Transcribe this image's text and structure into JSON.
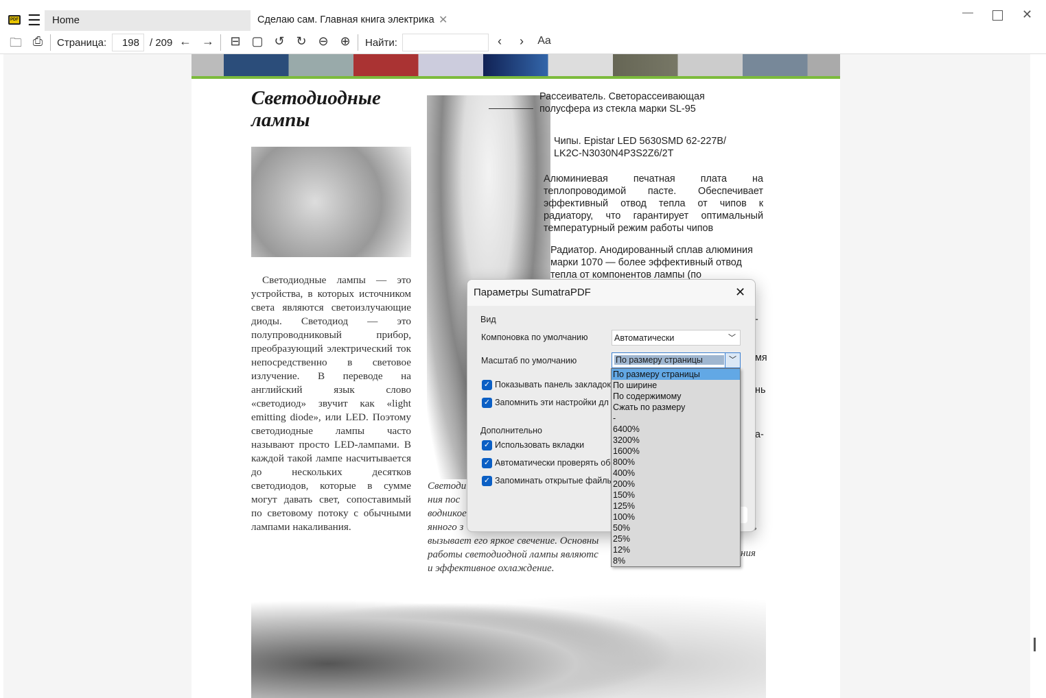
{
  "window": {
    "app_icon": "pdf-icon",
    "tabs": [
      {
        "label": "Home"
      },
      {
        "label": "Сделаю сам. Главная книга электрика"
      }
    ]
  },
  "toolbar": {
    "page_label": "Страница:",
    "page_value": "198",
    "page_total": "/ 209",
    "find_label": "Найти:",
    "find_value": ""
  },
  "document": {
    "title_line1": "Светодиодные",
    "title_line2": "лампы",
    "body": "Светодиодные лампы — это устройства, в которых источником света являются светоизлучающие диоды. Светодиод — это полупроводниковый прибор, преобразующий электрический ток непосредственно в световое излучение. В переводе на английский язык слово «светодиод» звучит как «light emitting diode», или LED. Поэтому светодиодные лампы часто называют просто LED-лампами. В каждой такой лампе насчитывается до нескольких десятков светодиодов, которые в сумме могут давать свет, сопоставимый по световому потоку с обычными лампами накаливания.",
    "annotations": [
      "Рассеиватель. Светорассеивающая полусфера из стекла марки SL-95",
      "Чипы. Epistar LED 5630SMD 62-227B/ LK2C-N3030N4P3S2Z6/2T",
      "Алюминиевая печатная плата на теплопроводимой пасте. Обеспечивает эффективный отвод тепла от чипов к радиатору, что гарантирует оптимальный температурный режим работы чипов",
      "Радиатор. Анодированный сплав алюминия марки 1070 — более эффективный отвод тепла от компонентов лампы (по"
    ],
    "caption_lines": [
      "Светоди",
      "ния пос",
      "водникое",
      "янного з",
      "вызывает его яркое свечение. Основны",
      "работы светодиодной лампы являютс",
      "и эффективное охлаждение."
    ],
    "caption_right": [
      "к,",
      "ния"
    ],
    "right_fragments": [
      "-",
      "мя",
      "нь",
      "а-"
    ]
  },
  "dialog": {
    "title": "Параметры SumatraPDF",
    "section_view": "Вид",
    "layout_label": "Компоновка по умолчанию",
    "layout_value": "Автоматически",
    "zoom_label": "Масштаб по умолчанию",
    "zoom_value": "По размеру страницы",
    "checks": [
      "Показывать панель закладок",
      "Запомнить эти настройки дл"
    ],
    "section_extra": "Дополнительно",
    "checks2": [
      "Использовать вкладки",
      "Автоматически проверять об",
      "Запоминать открытые файлы"
    ],
    "zoom_options": [
      "По размеру страницы",
      "По ширине",
      "По содержимому",
      "Сжать по размеру",
      "-",
      "6400%",
      "3200%",
      "1600%",
      "800%",
      "400%",
      "200%",
      "150%",
      "125%",
      "100%",
      "50%",
      "25%",
      "12%",
      "8%"
    ],
    "selected_option": 0
  }
}
